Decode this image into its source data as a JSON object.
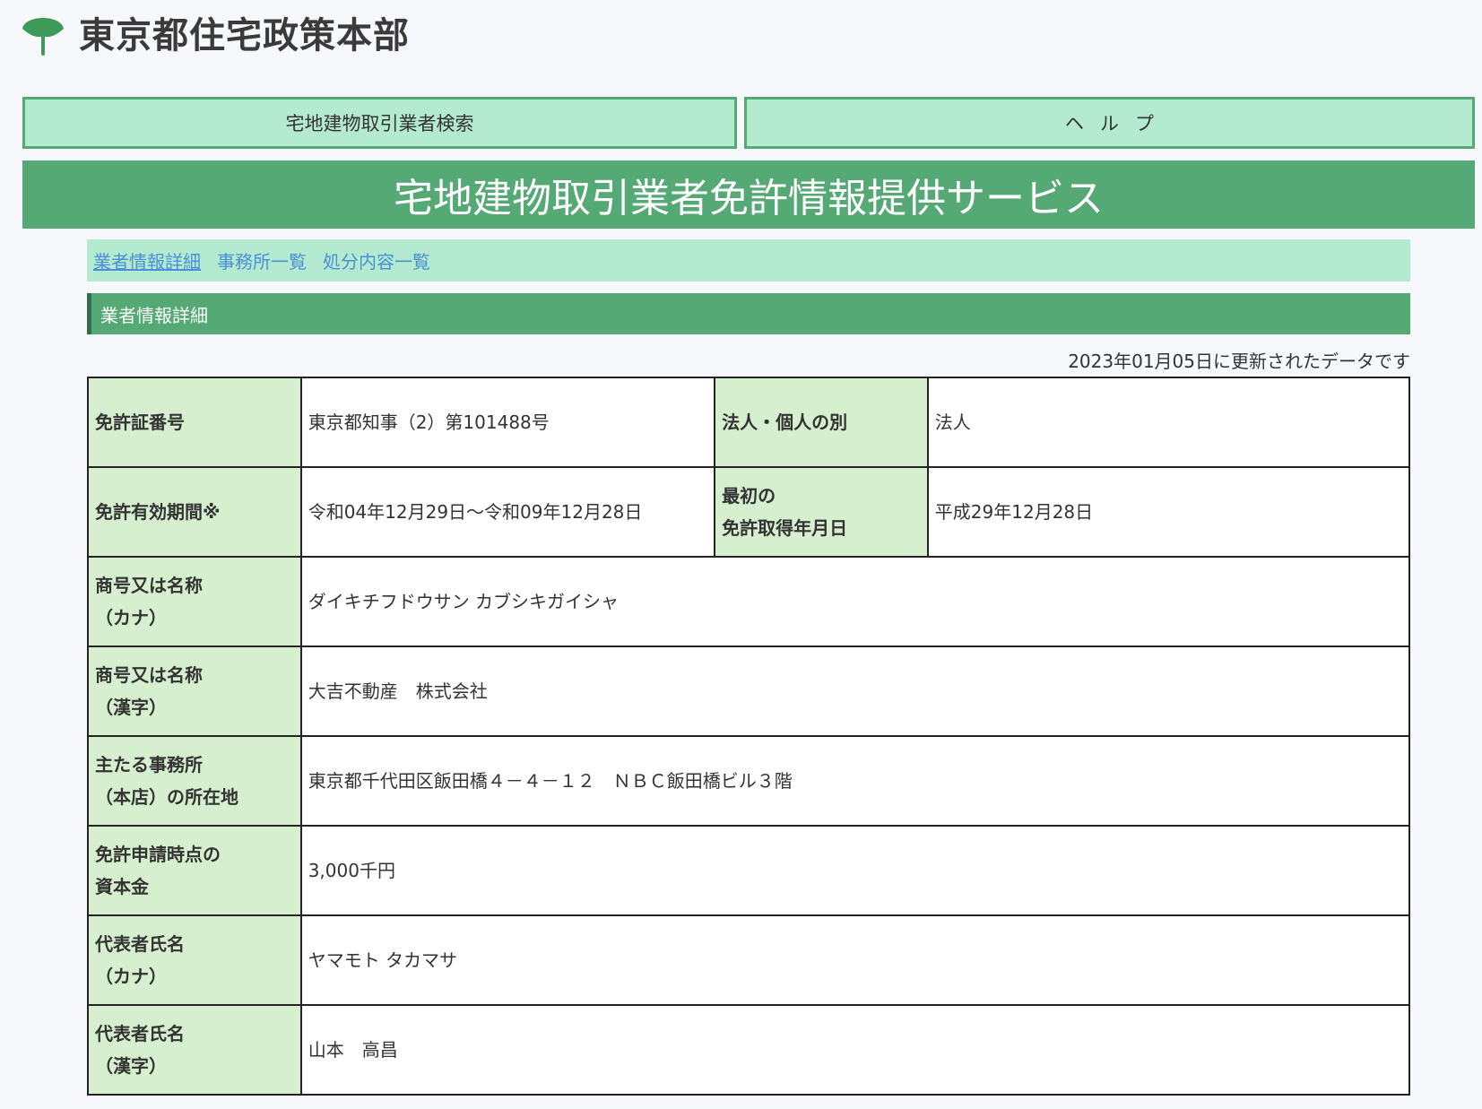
{
  "header": {
    "org_name": "東京都住宅政策本部"
  },
  "topnav": {
    "search_label": "宅地建物取引業者検索",
    "help_label": "ヘルプ"
  },
  "banner": {
    "title": "宅地建物取引業者免許情報提供サービス"
  },
  "subnav": {
    "items": [
      {
        "label": "業者情報詳細"
      },
      {
        "label": "事務所一覧"
      },
      {
        "label": "処分内容一覧"
      }
    ]
  },
  "section": {
    "title": "業者情報詳細"
  },
  "updated_text": "2023年01月05日に更新されたデータです",
  "details": {
    "license_no": {
      "label": "免許証番号",
      "value": "東京都知事（2）第101488号"
    },
    "entity_type": {
      "label": "法人・個人の別",
      "value": "法人"
    },
    "validity": {
      "label": "免許有効期間※",
      "value": "令和04年12月29日～令和09年12月28日"
    },
    "first_license": {
      "label_line1": "最初の",
      "label_line2": "免許取得年月日",
      "value": "平成29年12月28日"
    },
    "name_kana": {
      "label_line1": "商号又は名称",
      "label_line2": "（カナ）",
      "value": "ダイキチフドウサン カブシキガイシャ"
    },
    "name_kanji": {
      "label_line1": "商号又は名称",
      "label_line2": "（漢字）",
      "value": "大吉不動産　株式会社"
    },
    "address": {
      "label_line1": "主たる事務所",
      "label_line2": "（本店）の所在地",
      "value": "東京都千代田区飯田橋４－４－１２　ＮＢＣ飯田橋ビル３階"
    },
    "capital": {
      "label_line1": "免許申請時点の",
      "label_line2": "資本金",
      "value": "3,000千円"
    },
    "rep_kana": {
      "label_line1": "代表者氏名",
      "label_line2": "（カナ）",
      "value": "ヤマモト タカマサ"
    },
    "rep_kanji": {
      "label_line1": "代表者氏名",
      "label_line2": "（漢字）",
      "value": "山本　高昌"
    }
  },
  "colors": {
    "primary_green": "#55a974",
    "light_green": "#b4ead0",
    "label_bg": "#d6efcf",
    "link_blue": "#4a8fd8"
  }
}
